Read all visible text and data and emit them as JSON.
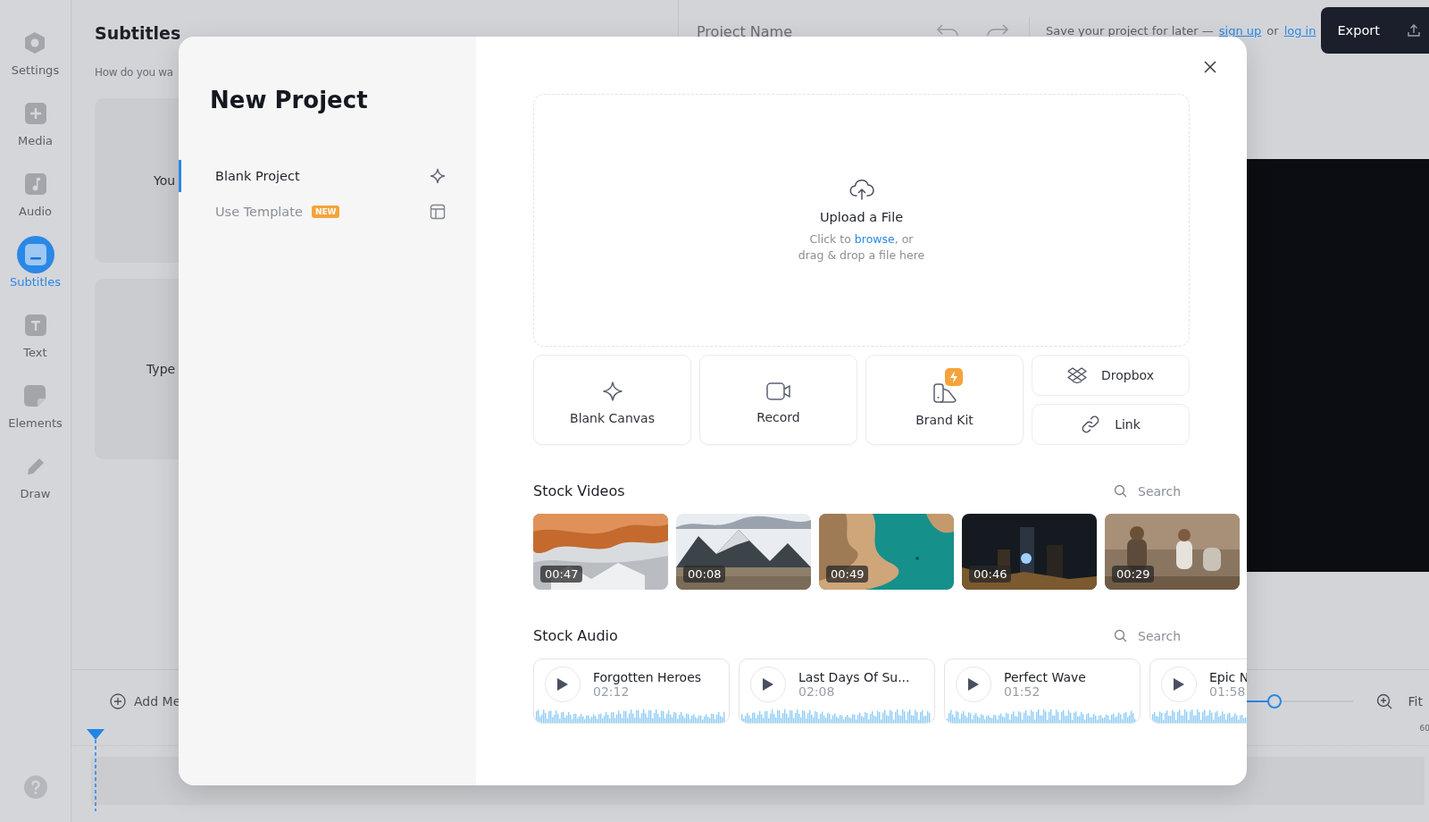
{
  "rail": [
    {
      "label": "Settings",
      "selected": false
    },
    {
      "label": "Media",
      "selected": false
    },
    {
      "label": "Audio",
      "selected": false
    },
    {
      "label": "Subtitles",
      "selected": true
    },
    {
      "label": "Text",
      "selected": false
    },
    {
      "label": "Elements",
      "selected": false
    },
    {
      "label": "Draw",
      "selected": false
    }
  ],
  "panel": {
    "title": "Subtitles",
    "prompt": "How do you wa",
    "options": [
      "You",
      "Type"
    ]
  },
  "top_bar": {
    "project_name_placeholder": "Project Name",
    "save_notice": "Save your project for later —",
    "sign_up": "sign up",
    "joiner": "or",
    "log_in": "log in",
    "export": "Export"
  },
  "timeline": {
    "add_media": "Add Me",
    "zoom": {
      "level": 0.42
    },
    "fit": "Fit",
    "tick": "60"
  },
  "modal": {
    "title": "New Project",
    "nav": [
      {
        "label": "Blank Project",
        "selected": true
      },
      {
        "label": "Use Template",
        "selected": false,
        "badge": "NEW"
      }
    ],
    "upload": {
      "title": "Upload a File",
      "hint_before": "Click to",
      "link": "browse",
      "hint_after": ", or",
      "hint_line2": "drag & drop a file here"
    },
    "sources": [
      {
        "label": "Blank Canvas",
        "kind": "tile",
        "premium": false
      },
      {
        "label": "Record",
        "kind": "tile",
        "premium": false
      },
      {
        "label": "Brand Kit",
        "kind": "tile",
        "premium": true
      },
      {
        "label": "Dropbox",
        "kind": "compact",
        "premium": false
      },
      {
        "label": "Link",
        "kind": "compact",
        "premium": false
      }
    ],
    "stock_videos": {
      "title": "Stock Videos",
      "search_placeholder": "Search",
      "items": [
        {
          "duration": "00:47"
        },
        {
          "duration": "00:08"
        },
        {
          "duration": "00:49"
        },
        {
          "duration": "00:46"
        },
        {
          "duration": "00:29"
        }
      ]
    },
    "stock_audio": {
      "title": "Stock Audio",
      "search_placeholder": "Search",
      "tracks": [
        {
          "title": "Forgotten Heroes",
          "duration": "02:12"
        },
        {
          "title": "Last Days Of Su...",
          "duration": "02:08"
        },
        {
          "title": "Perfect Wave",
          "duration": "01:52"
        },
        {
          "title": "Epic N",
          "duration": "01:58"
        }
      ]
    }
  }
}
